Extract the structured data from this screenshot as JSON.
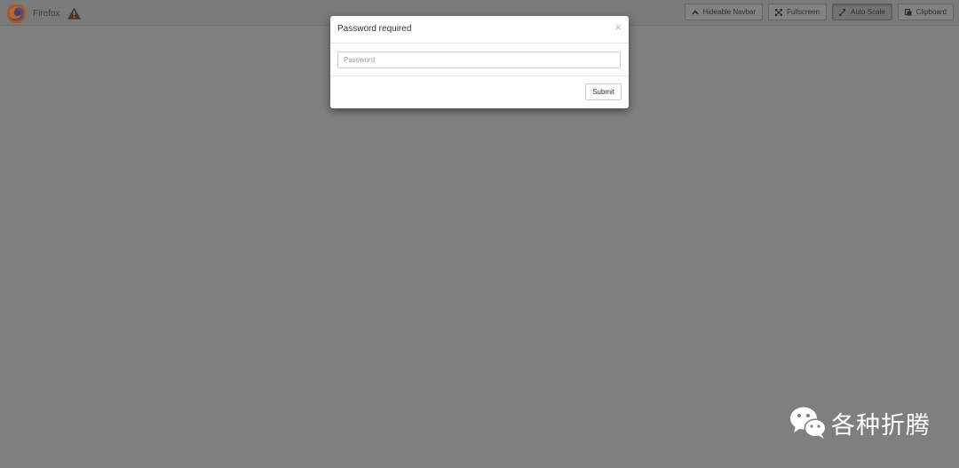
{
  "navbar": {
    "title": "Firefox",
    "logo_icon": "firefox-logo-icon",
    "status_icon": "warning-icon",
    "buttons": [
      {
        "label": "Hideable Navbar",
        "icon": "chevron-up-icon",
        "active": false
      },
      {
        "label": "Fullscreen",
        "icon": "fullscreen-icon",
        "active": false
      },
      {
        "label": "Auto Scale",
        "icon": "resize-icon",
        "active": true
      },
      {
        "label": "Clipboard",
        "icon": "clipboard-icon",
        "active": false
      }
    ]
  },
  "modal": {
    "title": "Password required",
    "close_label": "×",
    "password_placeholder": "Password",
    "password_value": "",
    "submit_label": "Submit"
  },
  "watermark": {
    "text": "各种折腾",
    "icon": "wechat-icon"
  },
  "colors": {
    "backdrop": "#7f7f7f",
    "modal_background": "#ffffff",
    "watermark_text": "#ffffff"
  }
}
